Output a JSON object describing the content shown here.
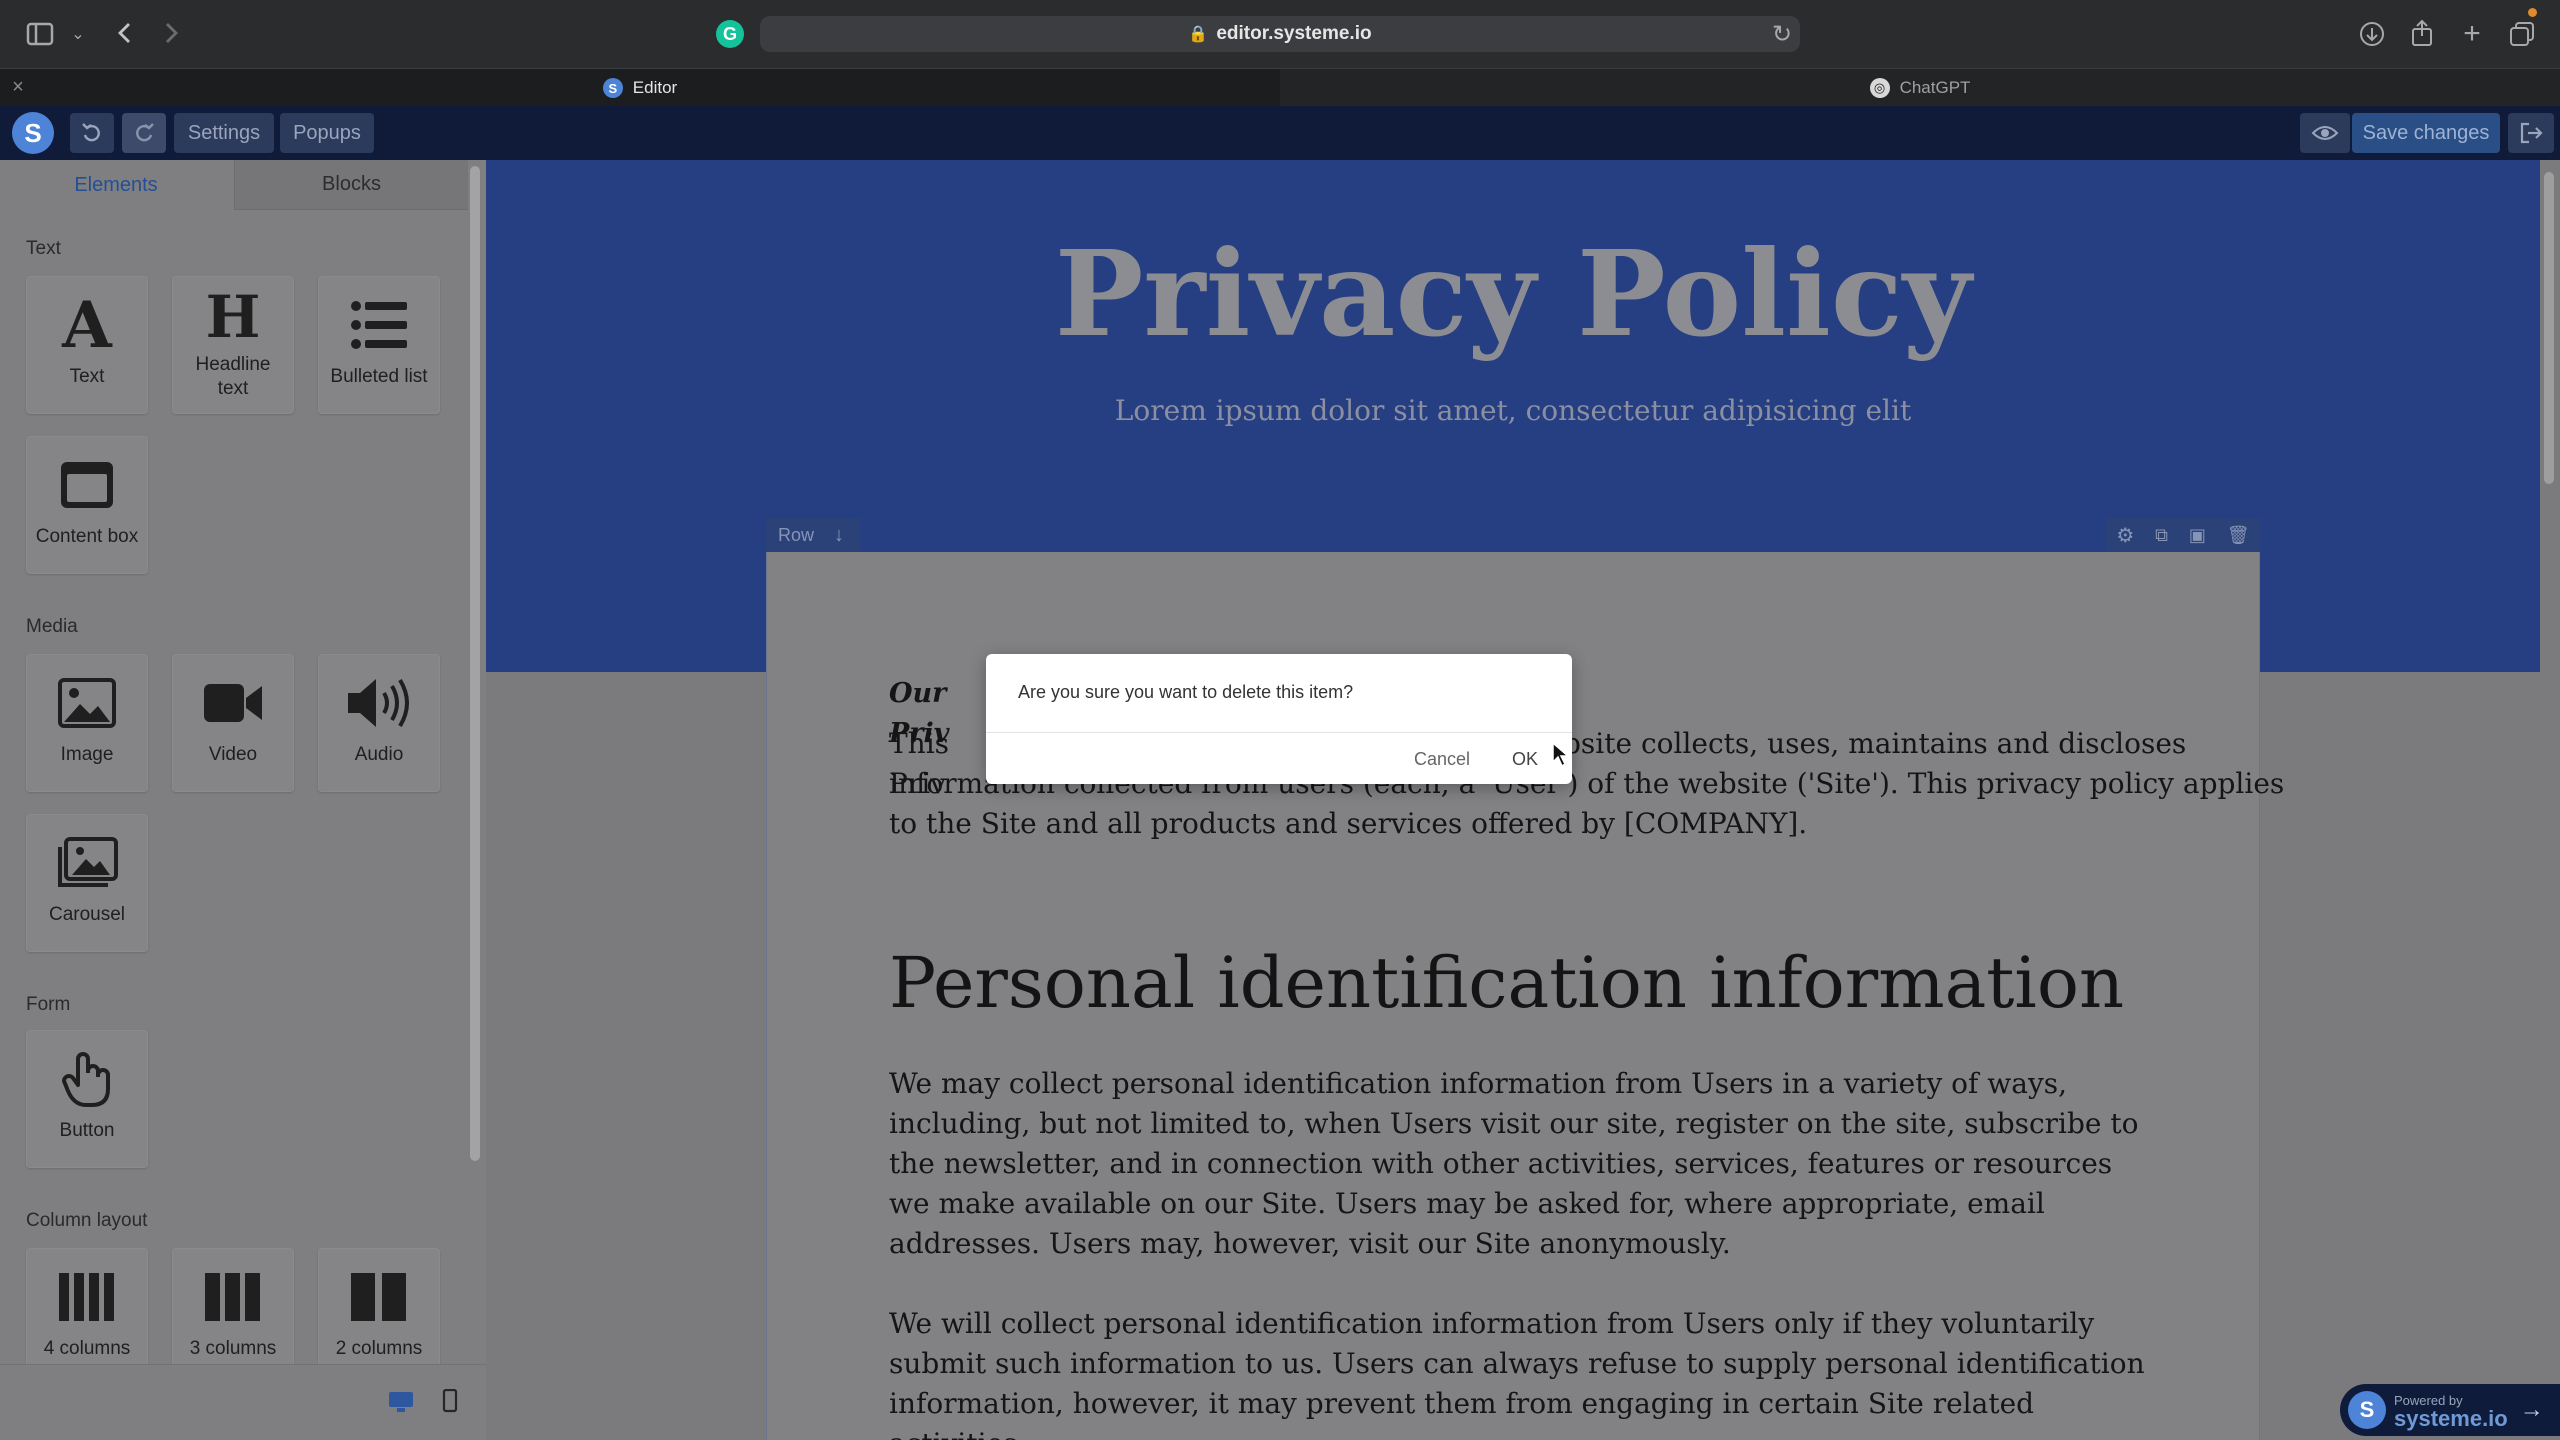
{
  "browser": {
    "url": "editor.systeme.io",
    "tabs": [
      {
        "label": "Editor",
        "active": true
      },
      {
        "label": "ChatGPT",
        "active": false
      }
    ]
  },
  "toolbar": {
    "logo": "S",
    "settings_label": "Settings",
    "popups_label": "Popups",
    "save_label": "Save changes"
  },
  "sidebar": {
    "tabs": [
      "Elements",
      "Blocks"
    ],
    "sections": {
      "text": "Text",
      "media": "Media",
      "form": "Form",
      "columns": "Column layout"
    },
    "items": {
      "text": "Text",
      "headline": "Headline text",
      "bulleted": "Bulleted list",
      "content_box": "Content box",
      "image": "Image",
      "video": "Video",
      "audio": "Audio",
      "carousel": "Carousel",
      "button": "Button",
      "col4": "4 columns",
      "col3": "3 columns",
      "col2": "2 columns"
    }
  },
  "page": {
    "title": "Privacy Policy",
    "subtitle": "Lorem ipsum dolor sit amet, consectetur adipisicing elit",
    "row_label": "Row",
    "intro_label": "Our Priv",
    "para1_visible_start": "This Priv",
    "para1_visible_end": "bsite collects, uses, maintains and discloses",
    "para1_line2": "information collected from users (each, a 'User') of the website ('Site'). This privacy policy applies",
    "para1_line3": "to the Site and all products and services offered by [COMPANY].",
    "heading": "Personal identification information",
    "para2": "We may collect personal identification information from Users in a variety of ways, including, but not limited to, when Users visit our site, register on the site, subscribe to the newsletter, and in connection with other activities, services, features or resources we make available on our Site. Users may be asked for, where appropriate, email addresses. Users may, however, visit our Site anonymously.",
    "para3": "We will collect personal identification information from Users only if they voluntarily submit such information to us. Users can always refuse to supply personal identification information, however, it may prevent them from engaging in certain Site related activities."
  },
  "dialog": {
    "message": "Are you sure you want to delete this item?",
    "cancel": "Cancel",
    "ok": "OK"
  },
  "badge": {
    "line1": "Powered by",
    "line2": "systeme.io"
  },
  "colors": {
    "hero": "#263f82",
    "toolbar": "#0f1b38",
    "accent": "#4d84d8"
  }
}
